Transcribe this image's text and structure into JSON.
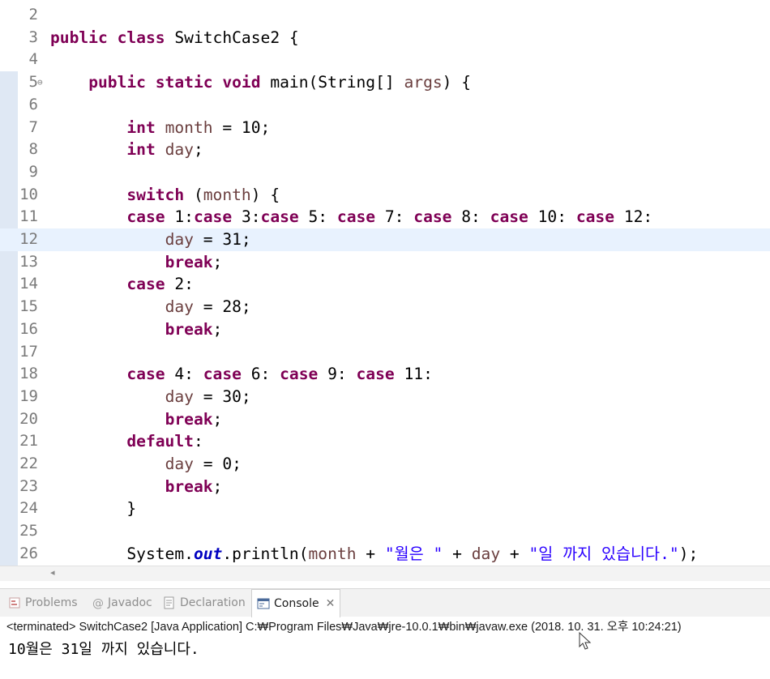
{
  "editor": {
    "lines": [
      {
        "num": "2",
        "tokens": []
      },
      {
        "num": "3",
        "tokens": [
          {
            "t": "public class ",
            "c": "kw"
          },
          {
            "t": "SwitchCase2 {",
            "c": "plain"
          }
        ]
      },
      {
        "num": "4",
        "tokens": []
      },
      {
        "num": "5",
        "fold": true,
        "tokens": [
          {
            "t": "    ",
            "c": "plain"
          },
          {
            "t": "public static void ",
            "c": "kw"
          },
          {
            "t": "main(String[] ",
            "c": "plain"
          },
          {
            "t": "args",
            "c": "var"
          },
          {
            "t": ") {",
            "c": "plain"
          }
        ]
      },
      {
        "num": "6",
        "tokens": []
      },
      {
        "num": "7",
        "tokens": [
          {
            "t": "        ",
            "c": "plain"
          },
          {
            "t": "int ",
            "c": "kw"
          },
          {
            "t": "month",
            "c": "var"
          },
          {
            "t": " = 10;",
            "c": "plain"
          }
        ]
      },
      {
        "num": "8",
        "tokens": [
          {
            "t": "        ",
            "c": "plain"
          },
          {
            "t": "int ",
            "c": "kw"
          },
          {
            "t": "day",
            "c": "var"
          },
          {
            "t": ";",
            "c": "plain"
          }
        ]
      },
      {
        "num": "9",
        "tokens": []
      },
      {
        "num": "10",
        "tokens": [
          {
            "t": "        ",
            "c": "plain"
          },
          {
            "t": "switch ",
            "c": "kw"
          },
          {
            "t": "(",
            "c": "plain"
          },
          {
            "t": "month",
            "c": "var"
          },
          {
            "t": ") {",
            "c": "plain"
          }
        ]
      },
      {
        "num": "11",
        "tokens": [
          {
            "t": "        ",
            "c": "plain"
          },
          {
            "t": "case ",
            "c": "kw"
          },
          {
            "t": "1:",
            "c": "plain"
          },
          {
            "t": "case ",
            "c": "kw"
          },
          {
            "t": "3:",
            "c": "plain"
          },
          {
            "t": "case ",
            "c": "kw"
          },
          {
            "t": "5: ",
            "c": "plain"
          },
          {
            "t": "case ",
            "c": "kw"
          },
          {
            "t": "7: ",
            "c": "plain"
          },
          {
            "t": "case ",
            "c": "kw"
          },
          {
            "t": "8: ",
            "c": "plain"
          },
          {
            "t": "case ",
            "c": "kw"
          },
          {
            "t": "10: ",
            "c": "plain"
          },
          {
            "t": "case ",
            "c": "kw"
          },
          {
            "t": "12:",
            "c": "plain"
          }
        ]
      },
      {
        "num": "12",
        "current": true,
        "tokens": [
          {
            "t": "            ",
            "c": "plain"
          },
          {
            "t": "day",
            "c": "var"
          },
          {
            "t": " = 31;",
            "c": "plain"
          }
        ]
      },
      {
        "num": "13",
        "tokens": [
          {
            "t": "            ",
            "c": "plain"
          },
          {
            "t": "break",
            "c": "kw"
          },
          {
            "t": ";",
            "c": "plain"
          }
        ]
      },
      {
        "num": "14",
        "tokens": [
          {
            "t": "        ",
            "c": "plain"
          },
          {
            "t": "case ",
            "c": "kw"
          },
          {
            "t": "2:",
            "c": "plain"
          }
        ]
      },
      {
        "num": "15",
        "tokens": [
          {
            "t": "            ",
            "c": "plain"
          },
          {
            "t": "day",
            "c": "var"
          },
          {
            "t": " = 28;",
            "c": "plain"
          }
        ]
      },
      {
        "num": "16",
        "tokens": [
          {
            "t": "            ",
            "c": "plain"
          },
          {
            "t": "break",
            "c": "kw"
          },
          {
            "t": ";",
            "c": "plain"
          }
        ]
      },
      {
        "num": "17",
        "tokens": []
      },
      {
        "num": "18",
        "tokens": [
          {
            "t": "        ",
            "c": "plain"
          },
          {
            "t": "case ",
            "c": "kw"
          },
          {
            "t": "4: ",
            "c": "plain"
          },
          {
            "t": "case ",
            "c": "kw"
          },
          {
            "t": "6: ",
            "c": "plain"
          },
          {
            "t": "case ",
            "c": "kw"
          },
          {
            "t": "9: ",
            "c": "plain"
          },
          {
            "t": "case ",
            "c": "kw"
          },
          {
            "t": "11:",
            "c": "plain"
          }
        ]
      },
      {
        "num": "19",
        "tokens": [
          {
            "t": "            ",
            "c": "plain"
          },
          {
            "t": "day",
            "c": "var"
          },
          {
            "t": " = 30;",
            "c": "plain"
          }
        ]
      },
      {
        "num": "20",
        "tokens": [
          {
            "t": "            ",
            "c": "plain"
          },
          {
            "t": "break",
            "c": "kw"
          },
          {
            "t": ";",
            "c": "plain"
          }
        ]
      },
      {
        "num": "21",
        "tokens": [
          {
            "t": "        ",
            "c": "plain"
          },
          {
            "t": "default",
            "c": "kw"
          },
          {
            "t": ":",
            "c": "plain"
          }
        ]
      },
      {
        "num": "22",
        "tokens": [
          {
            "t": "            ",
            "c": "plain"
          },
          {
            "t": "day",
            "c": "var"
          },
          {
            "t": " = 0;",
            "c": "plain"
          }
        ]
      },
      {
        "num": "23",
        "tokens": [
          {
            "t": "            ",
            "c": "plain"
          },
          {
            "t": "break",
            "c": "kw"
          },
          {
            "t": ";",
            "c": "plain"
          }
        ]
      },
      {
        "num": "24",
        "tokens": [
          {
            "t": "        }",
            "c": "plain"
          }
        ]
      },
      {
        "num": "25",
        "tokens": []
      },
      {
        "num": "26",
        "tokens": [
          {
            "t": "        System.",
            "c": "plain"
          },
          {
            "t": "out",
            "c": "field"
          },
          {
            "t": ".println(",
            "c": "plain"
          },
          {
            "t": "month",
            "c": "var"
          },
          {
            "t": " + ",
            "c": "plain"
          },
          {
            "t": "\"월은 \"",
            "c": "str"
          },
          {
            "t": " + ",
            "c": "plain"
          },
          {
            "t": "day",
            "c": "var"
          },
          {
            "t": " + ",
            "c": "plain"
          },
          {
            "t": "\"일 까지 있습니다.\"",
            "c": "str"
          },
          {
            "t": ");",
            "c": "plain"
          }
        ]
      }
    ]
  },
  "panel": {
    "tabs": [
      {
        "label": "Problems",
        "icon": "problems-icon",
        "active": false
      },
      {
        "label": "Javadoc",
        "icon": "javadoc-icon",
        "active": false
      },
      {
        "label": "Declaration",
        "icon": "declaration-icon",
        "active": false
      },
      {
        "label": "Console",
        "icon": "console-icon",
        "active": true,
        "close": "✕"
      }
    ],
    "status": "<terminated> SwitchCase2 [Java Application] C:₩Program Files₩Java₩jre-10.0.1₩bin₩javaw.exe (2018. 10. 31. 오후 10:24:21)",
    "output": "10월은 31일 까지 있습니다."
  },
  "colors": {
    "keyword": "#7f0055",
    "variable": "#6a3e3e",
    "string": "#2a00ff",
    "field": "#0000c0",
    "current_line": "#e8f2fe"
  }
}
